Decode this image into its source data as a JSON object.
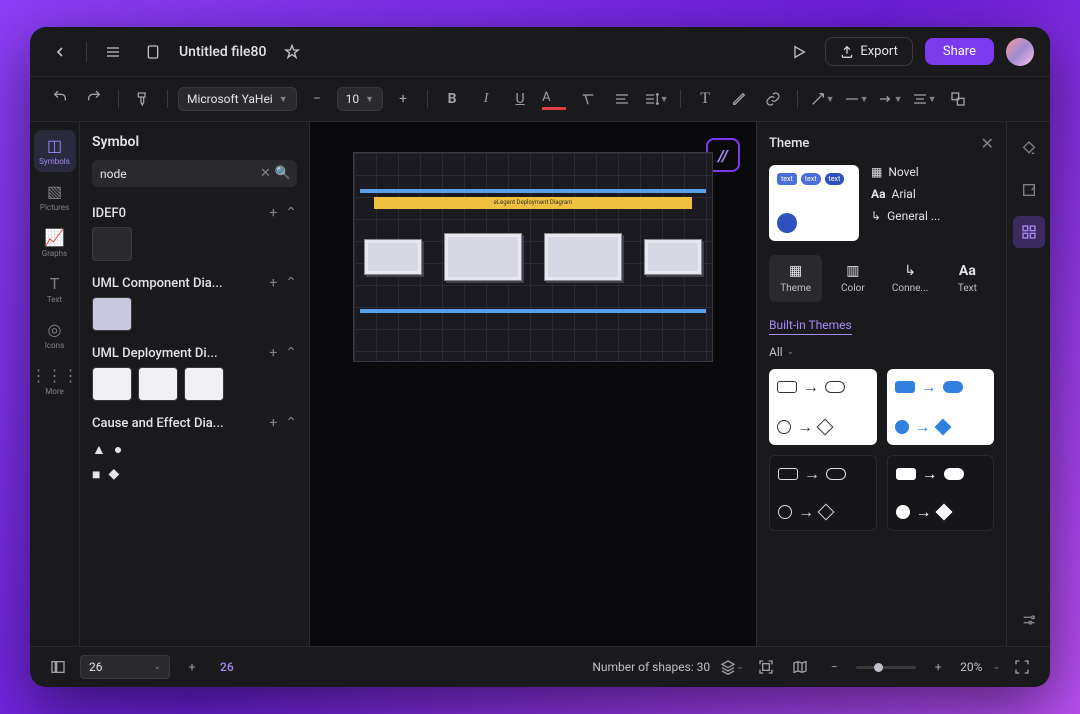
{
  "header": {
    "title": "Untitled file80",
    "export_label": "Export",
    "share_label": "Share"
  },
  "toolbar": {
    "font_family": "Microsoft YaHei",
    "font_size": "10"
  },
  "rail": {
    "symbols": "Symbols",
    "pictures": "Pictures",
    "graphs": "Graphs",
    "text": "Text",
    "icons": "Icons",
    "more": "More"
  },
  "sympanel": {
    "title": "Symbol",
    "search_value": "node",
    "categories": [
      {
        "name": "IDEF0"
      },
      {
        "name": "UML Component Dia..."
      },
      {
        "name": "UML Deployment Di..."
      },
      {
        "name": "Cause and Effect Dia..."
      }
    ]
  },
  "canvas": {
    "diagram_title": "eLegent Deployment Diagram"
  },
  "themepanel": {
    "title": "Theme",
    "props": {
      "color": "Novel",
      "font": "Arial",
      "connector": "General ..."
    },
    "tabs": {
      "theme": "Theme",
      "color": "Color",
      "connector": "Conne...",
      "text": "Text"
    },
    "builtin_label": "Built-in Themes",
    "filter_label": "All"
  },
  "bottombar": {
    "page_value": "26",
    "page_current": "26",
    "shapes_label": "Number of shapes: 30",
    "zoom_pct": "20%"
  }
}
